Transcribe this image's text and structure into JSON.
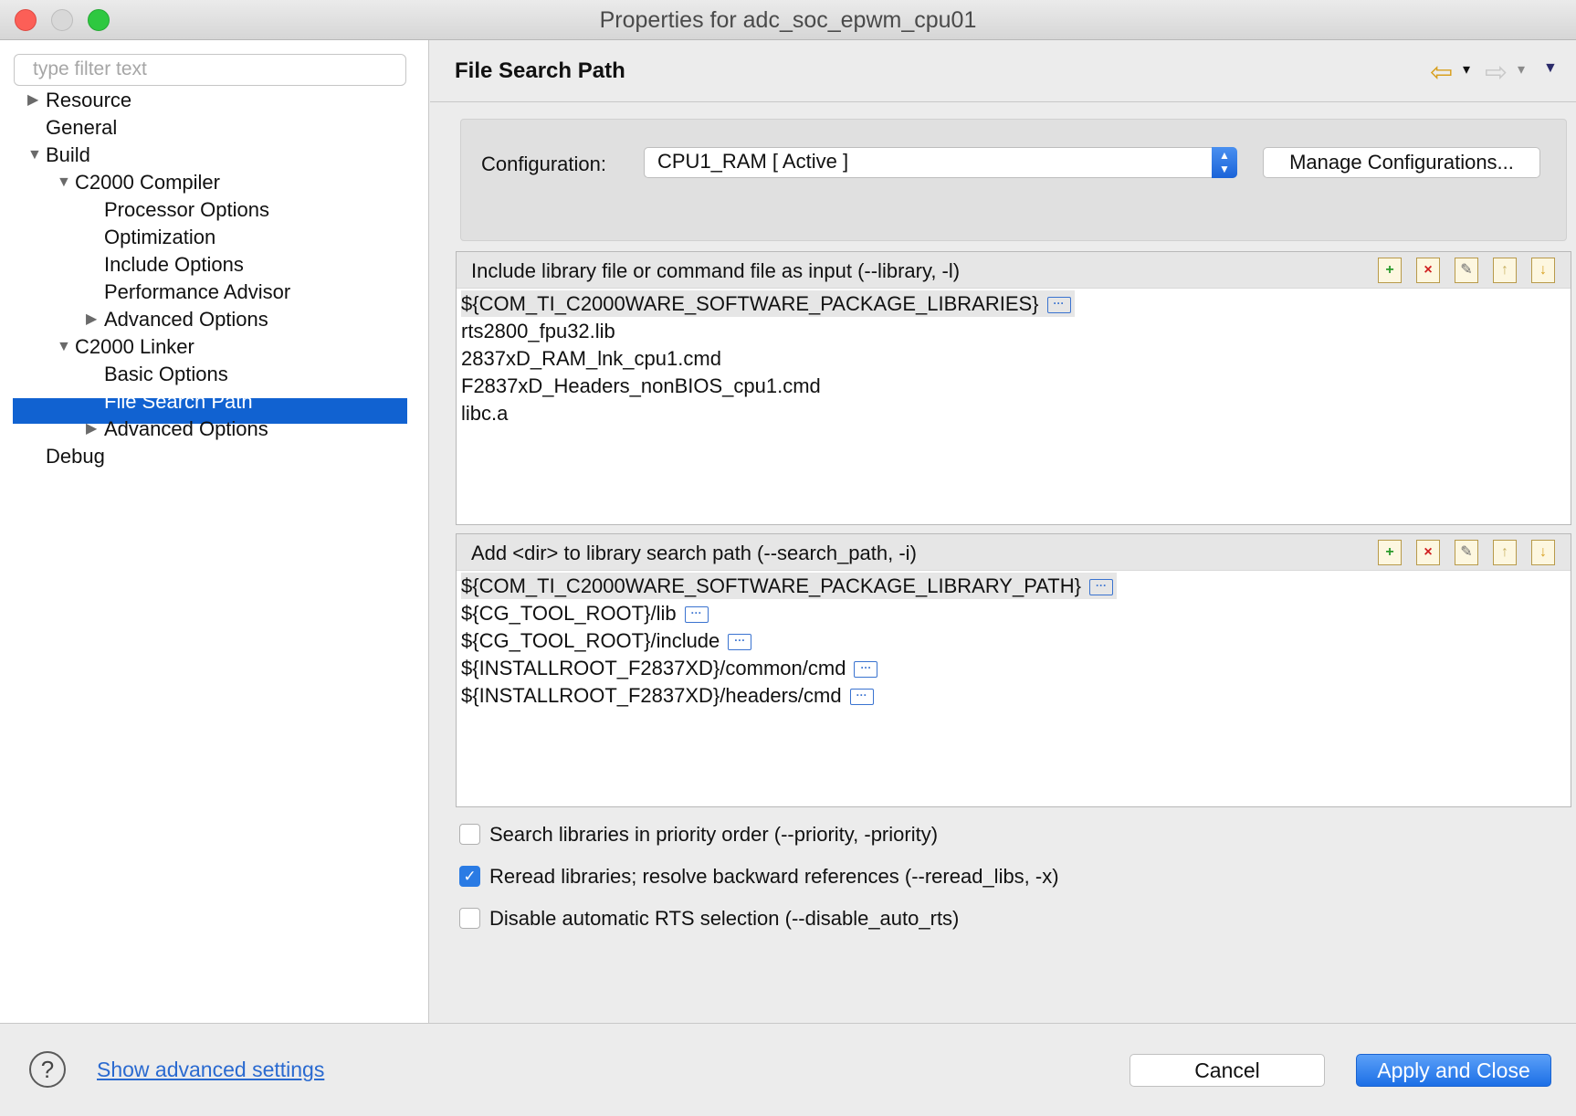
{
  "window": {
    "title": "Properties for adc_soc_epwm_cpu01"
  },
  "filter": {
    "placeholder": "type filter text"
  },
  "tree": [
    {
      "label": "Resource",
      "arrow": "▶"
    },
    {
      "label": "General",
      "arrow": ""
    },
    {
      "label": "Build",
      "arrow": "▼"
    },
    {
      "label": "C2000 Compiler",
      "arrow": "▼"
    },
    {
      "label": "Processor Options",
      "arrow": ""
    },
    {
      "label": "Optimization",
      "arrow": ""
    },
    {
      "label": "Include Options",
      "arrow": ""
    },
    {
      "label": "Performance Advisor",
      "arrow": ""
    },
    {
      "label": "Advanced Options",
      "arrow": "▶"
    },
    {
      "label": "C2000 Linker",
      "arrow": "▼"
    },
    {
      "label": "Basic Options",
      "arrow": ""
    },
    {
      "label": "File Search Path",
      "arrow": "",
      "selected": true
    },
    {
      "label": "Advanced Options",
      "arrow": "▶"
    },
    {
      "label": "Debug",
      "arrow": ""
    }
  ],
  "page": {
    "title": "File Search Path"
  },
  "nav": {
    "back_icon": "⇦",
    "forward_icon": "⇨",
    "dropdown": "▾",
    "menu": "▼"
  },
  "config": {
    "label": "Configuration:",
    "value": "CPU1_RAM  [ Active ]",
    "manage_label": "Manage Configurations..."
  },
  "library_panel": {
    "title": "Include library file or command file as input (--library, -l)",
    "items": [
      {
        "text": "${COM_TI_C2000WARE_SOFTWARE_PACKAGE_LIBRARIES}",
        "dots": true
      },
      {
        "text": "rts2800_fpu32.lib",
        "dots": false
      },
      {
        "text": "2837xD_RAM_lnk_cpu1.cmd",
        "dots": false
      },
      {
        "text": "F2837xD_Headers_nonBIOS_cpu1.cmd",
        "dots": false
      },
      {
        "text": "libc.a",
        "dots": false
      }
    ]
  },
  "search_panel": {
    "title": "Add <dir> to library search path (--search_path, -i)",
    "items": [
      {
        "text": "${COM_TI_C2000WARE_SOFTWARE_PACKAGE_LIBRARY_PATH}",
        "dots": true
      },
      {
        "text": "${CG_TOOL_ROOT}/lib",
        "dots": true
      },
      {
        "text": "${CG_TOOL_ROOT}/include",
        "dots": true
      },
      {
        "text": "${INSTALLROOT_F2837XD}/common/cmd",
        "dots": true
      },
      {
        "text": "${INSTALLROOT_F2837XD}/headers/cmd",
        "dots": true
      }
    ]
  },
  "tool_icons": [
    "add-icon",
    "delete-icon",
    "edit-icon",
    "move-up-icon",
    "move-down-icon"
  ],
  "options": [
    {
      "label": "Search libraries in priority order (--priority, -priority)",
      "checked": false
    },
    {
      "label": "Reread libraries; resolve backward references (--reread_libs, -x)",
      "checked": true
    },
    {
      "label": "Disable automatic RTS selection (--disable_auto_rts)",
      "checked": false
    }
  ],
  "footer": {
    "help_icon": "?",
    "advanced_link": "Show advanced settings",
    "cancel_label": "Cancel",
    "apply_label": "Apply and Close"
  },
  "colors": {
    "selection": "#1162d1",
    "accent": "#1c6fe6",
    "link": "#2a6ad0"
  }
}
